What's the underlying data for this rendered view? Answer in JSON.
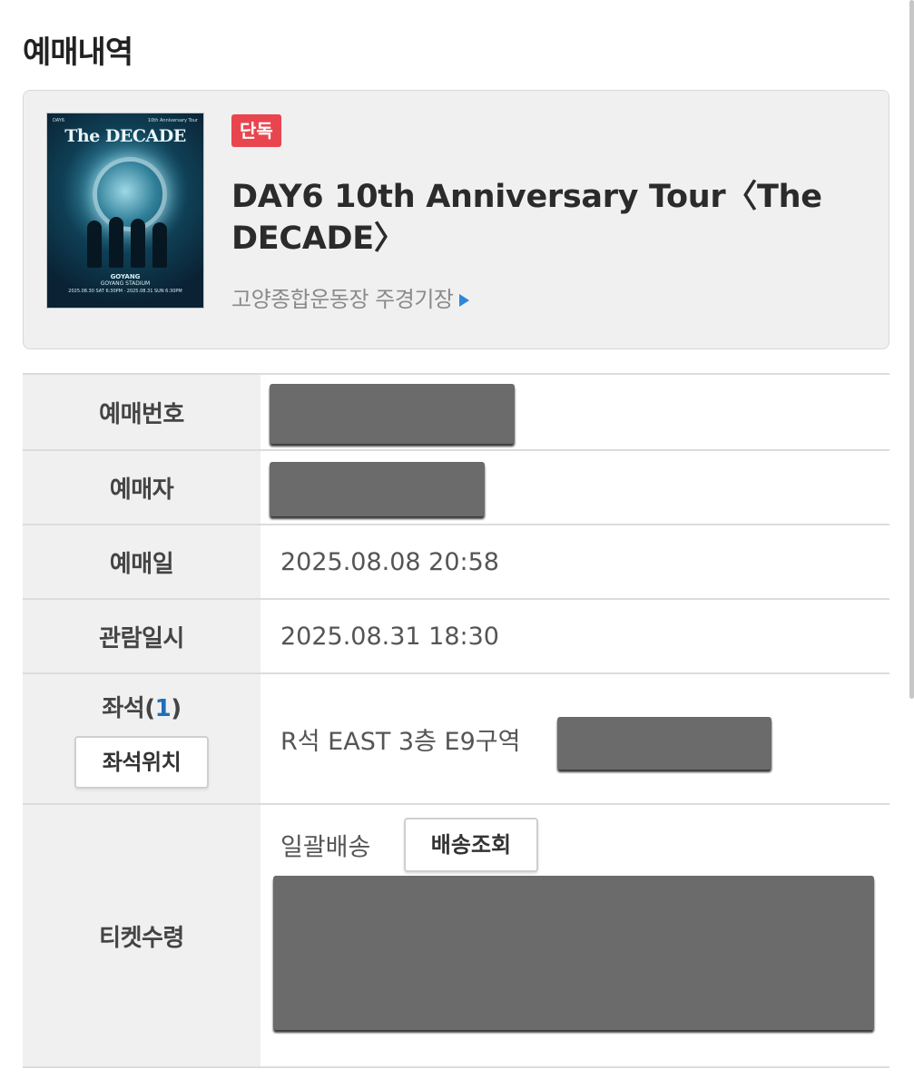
{
  "page": {
    "title": "예매내역"
  },
  "performance": {
    "badge": "단독",
    "title": "DAY6 10th Anniversary Tour〈The DECADE〉",
    "venue": "고양종합운동장 주경기장",
    "poster": {
      "top_left": "DAY6",
      "top_right": "10th Anniversary Tour",
      "title": "The DECADE",
      "city": "GOYANG",
      "stadium": "GOYANG STADIUM",
      "dates": "2025.08.30 SAT 6:30PM · 2025.08.31 SUN 6:30PM"
    }
  },
  "details": {
    "booking_number_label": "예매번호",
    "booker_label": "예매자",
    "booking_date_label": "예매일",
    "booking_date_value": "2025.08.08 20:58",
    "view_datetime_label": "관람일시",
    "view_datetime_value": "2025.08.31 18:30",
    "seat_label_prefix": "좌석(",
    "seat_count": "1",
    "seat_label_suffix": ")",
    "seat_location_button": "좌석위치",
    "seat_value": "R석 EAST 3층 E9구역",
    "ticket_label": "티켓수령",
    "delivery_method": "일괄배송",
    "delivery_check_button": "배송조회"
  }
}
